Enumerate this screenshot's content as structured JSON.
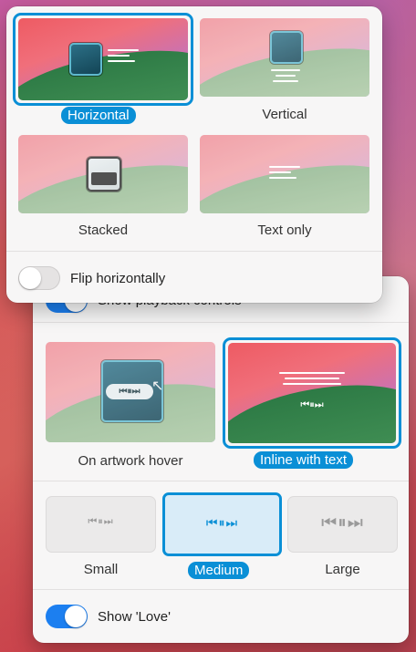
{
  "layout_panel": {
    "options": [
      {
        "label": "Horizontal",
        "selected": true
      },
      {
        "label": "Vertical",
        "selected": false
      },
      {
        "label": "Stacked",
        "selected": false
      },
      {
        "label": "Text only",
        "selected": false
      }
    ],
    "flip_toggle": {
      "label": "Flip horizontally",
      "on": false
    }
  },
  "controls_panel": {
    "playback_toggle": {
      "label": "Show playback controls",
      "on": true
    },
    "position_options": [
      {
        "label": "On artwork hover",
        "selected": false
      },
      {
        "label": "Inline with text",
        "selected": true
      }
    ],
    "size_options": [
      {
        "label": "Small",
        "selected": false
      },
      {
        "label": "Medium",
        "selected": true
      },
      {
        "label": "Large",
        "selected": false
      }
    ],
    "love_toggle": {
      "label": "Show 'Love'",
      "on": true
    }
  },
  "icons": {
    "transport_glyph": "⏮⏸⏭",
    "transport_glyph_hover": "⏮⏸⏭"
  },
  "colors": {
    "accent": "#0a8fd6",
    "toggle_on": "#1c7ff0"
  }
}
